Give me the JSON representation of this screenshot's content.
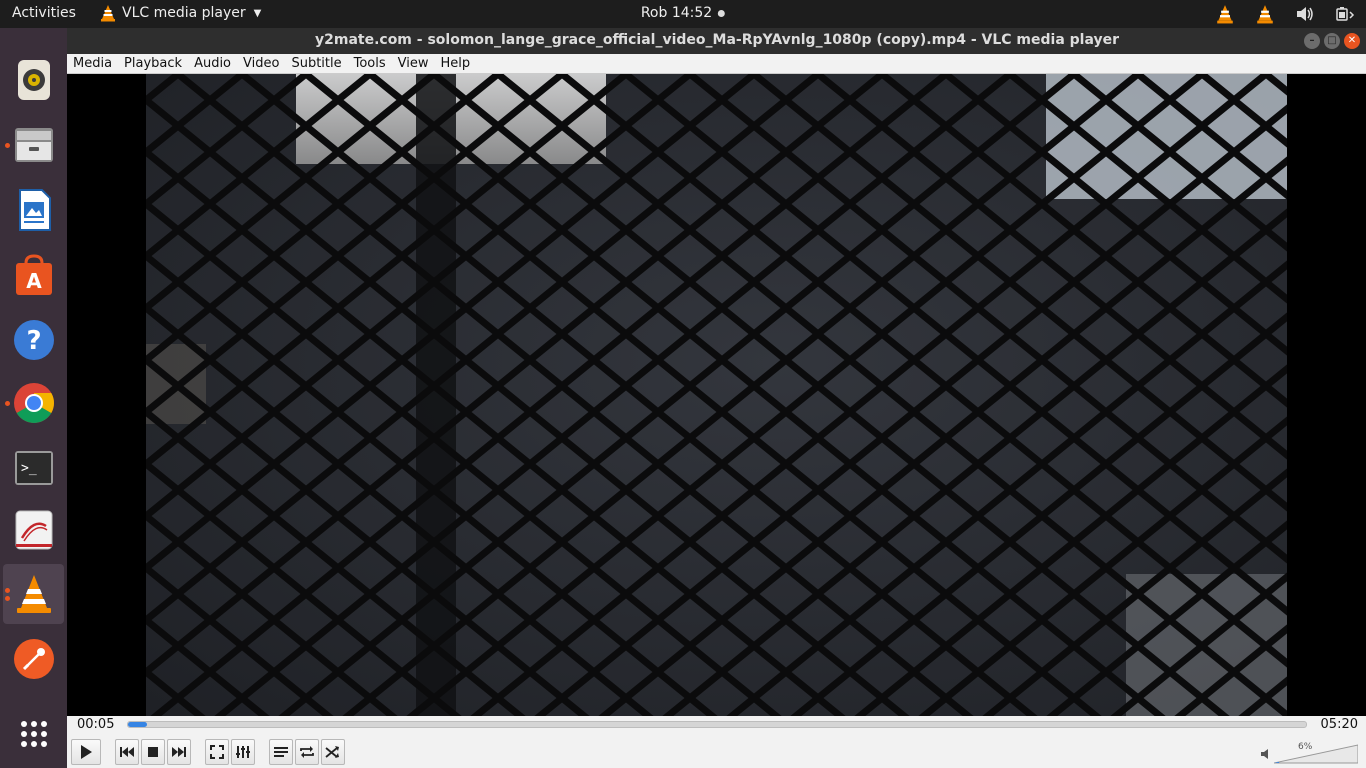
{
  "topbar": {
    "activities": "Activities",
    "app_name": "VLC media player",
    "clock": "Rob 14:52"
  },
  "window": {
    "title": "y2mate.com - solomon_lange_grace_official_video_Ma-RpYAvnlg_1080p (copy).mp4 - VLC media player"
  },
  "menu": [
    {
      "label": "Media"
    },
    {
      "label": "Playback"
    },
    {
      "label": "Audio"
    },
    {
      "label": "Video"
    },
    {
      "label": "Subtitle"
    },
    {
      "label": "Tools"
    },
    {
      "label": "View"
    },
    {
      "label": "Help"
    }
  ],
  "player": {
    "elapsed": "00:05",
    "total": "05:20",
    "progress_fraction": 0.016,
    "volume_label": "6%",
    "volume_fraction": 0.06
  },
  "dock": [
    {
      "icon": "rhythmbox-icon",
      "active": false,
      "running": false
    },
    {
      "icon": "files-icon",
      "active": false,
      "running": true
    },
    {
      "icon": "libreoffice-writer-icon",
      "active": false,
      "running": false
    },
    {
      "icon": "software-center-icon",
      "active": false,
      "running": false
    },
    {
      "icon": "help-icon",
      "active": false,
      "running": false
    },
    {
      "icon": "chrome-icon",
      "active": false,
      "running": true
    },
    {
      "icon": "terminal-icon",
      "active": false,
      "running": false
    },
    {
      "icon": "document-viewer-icon",
      "active": false,
      "running": false
    },
    {
      "icon": "vlc-icon",
      "active": true,
      "running": true
    },
    {
      "icon": "postman-icon",
      "active": false,
      "running": false
    },
    {
      "icon": "show-apps-icon",
      "active": false,
      "running": false
    }
  ],
  "colors": {
    "accent": "#e95420",
    "seek_fill": "#3584e4",
    "dock_bg": "#3a2f3a"
  }
}
